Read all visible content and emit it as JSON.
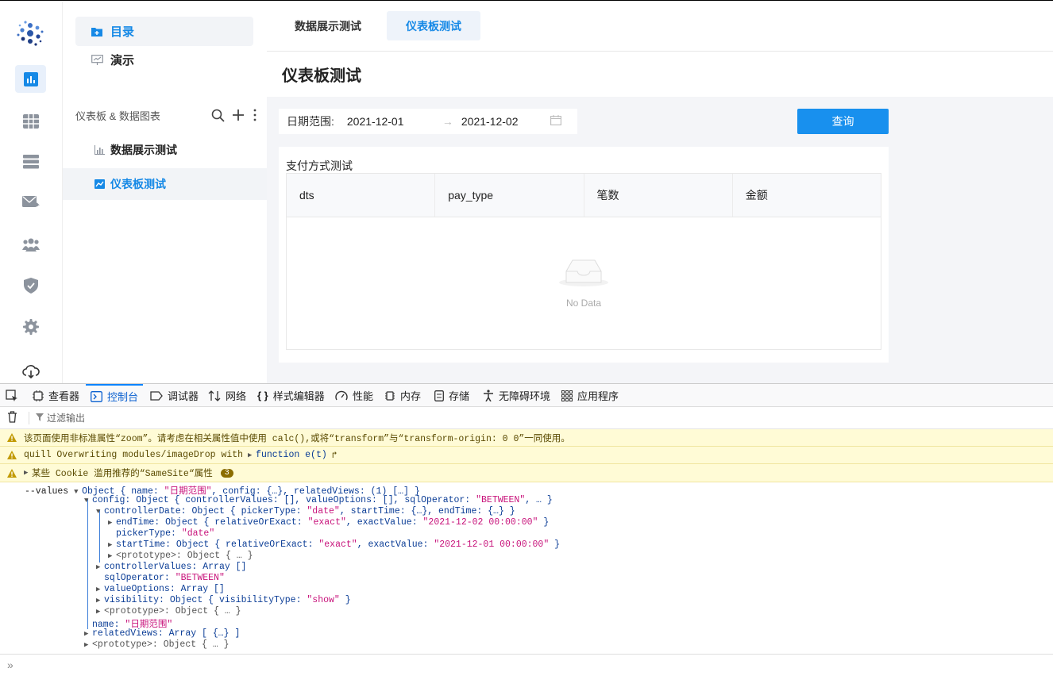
{
  "rail": {
    "icons": [
      "logo-icon",
      "dashboard-icon",
      "table-icon",
      "list-icon",
      "mail-icon",
      "users-icon",
      "shield-icon",
      "gear-icon",
      "cloud-download-icon"
    ]
  },
  "tree": {
    "top_items": [
      {
        "label": "目录",
        "icon": "folder-plus-icon"
      },
      {
        "label": "演示",
        "icon": "presentation-icon"
      }
    ],
    "section_title": "仪表板 & 数据图表",
    "items": [
      {
        "label": "数据展示测试",
        "icon": "bar-chart-icon"
      },
      {
        "label": "仪表板测试",
        "icon": "line-chart-icon"
      }
    ]
  },
  "main": {
    "tabs": [
      "数据展示测试",
      "仪表板测试"
    ],
    "page_title": "仪表板测试",
    "filter": {
      "label": "日期范围:",
      "start": "2021-12-01",
      "end": "2021-12-02"
    },
    "query_button": "查询",
    "card": {
      "title": "支付方式测试",
      "columns": [
        "dts",
        "pay_type",
        "笔数",
        "金额"
      ],
      "empty_text": "No Data"
    }
  },
  "devtools": {
    "tabs": [
      "查看器",
      "控制台",
      "调试器",
      "网络",
      "样式编辑器",
      "性能",
      "内存",
      "存储",
      "无障碍环境",
      "应用程序"
    ],
    "filter_placeholder": "过滤输出",
    "warnings": [
      "该页面使用非标准属性“zoom”。请考虑在相关属性值中使用 calc(),或将“transform”与“transform-origin: 0 0”一同使用。",
      "quill Overwriting modules/imageDrop with",
      "某些 Cookie 滥用推荐的“SameSite“属性"
    ],
    "warning2_fn": "function e(t)",
    "cookie_badge": "3",
    "log": {
      "label": "--values",
      "l1_k": "Object",
      "l1_rest": "{ name: ",
      "l1_s": "\"日期范围\"",
      "l1_tail": ", config: {…}, relatedViews: (1) […] }",
      "config_key": "config:",
      "config_type": "Object",
      "config_rest": "{ controllerValues: [], valueOptions: [], sqlOperator: ",
      "config_s": "\"BETWEEN\"",
      "config_tail": ", … }",
      "cd_key": "controllerDate:",
      "cd_type": "Object",
      "cd_rest": "{ pickerType: ",
      "cd_s": "\"date\"",
      "cd_tail": ", startTime: {…}, endTime: {…} }",
      "et_key": "endTime:",
      "et_type": "Object",
      "et_rest": "{ relativeOrExact: ",
      "et_s1": "\"exact\"",
      "et_mid": ", exactValue: ",
      "et_s2": "\"2021-12-02 00:00:00\"",
      "et_tail": " }",
      "pt_key": "pickerType:",
      "pt_s": "\"date\"",
      "st_key": "startTime:",
      "st_type": "Object",
      "st_rest": "{ relativeOrExact: ",
      "st_s1": "\"exact\"",
      "st_mid": ", exactValue: ",
      "st_s2": "\"2021-12-01 00:00:00\"",
      "st_tail": " }",
      "proto": "<prototype>: Object { … }",
      "cv_key": "controllerValues:",
      "cv_val": "Array []",
      "so_key": "sqlOperator:",
      "so_s": "\"BETWEEN\"",
      "vo_key": "valueOptions:",
      "vo_val": "Array []",
      "vis_key": "visibility:",
      "vis_type": "Object",
      "vis_rest": "{ visibilityType: ",
      "vis_s": "\"show\"",
      "vis_tail": " }",
      "name_key": "name:",
      "name_s": "\"日期范围\"",
      "rv_key": "relatedViews:",
      "rv_val": "Array [ {…} ]"
    },
    "prompt": "»"
  }
}
